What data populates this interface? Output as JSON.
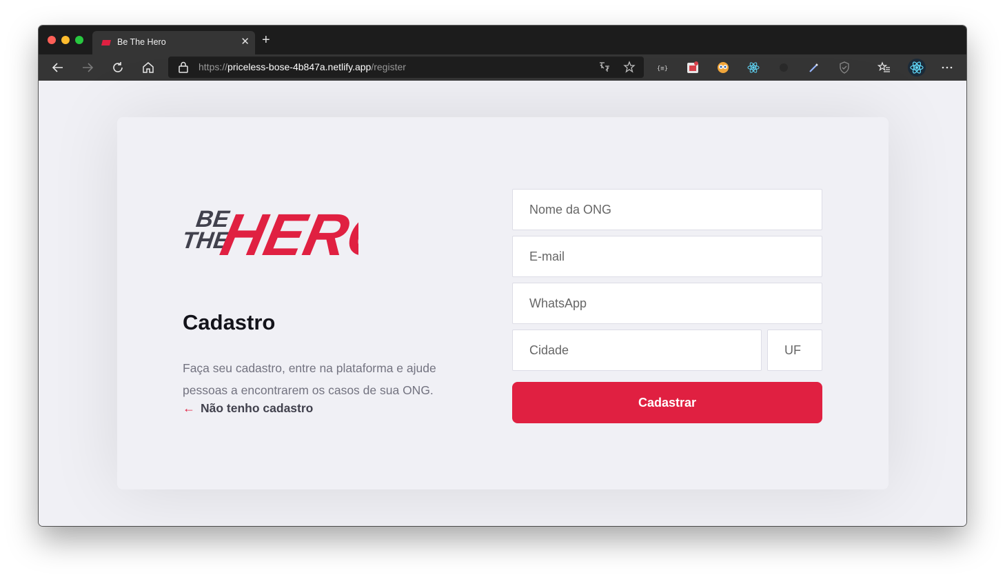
{
  "browser": {
    "tab": {
      "title": "Be The Hero"
    },
    "url": {
      "prefix": "https://",
      "host": "priceless-bose-4b847a.netlify.app",
      "path": "/register"
    },
    "icons": [
      "back-icon",
      "forward-icon",
      "reload-icon",
      "home-icon",
      "lock-icon",
      "translate-icon",
      "star-icon",
      "favorites-icon",
      "profile-icon",
      "more-icon"
    ]
  },
  "page": {
    "logo": {
      "line1": "BE",
      "line2": "THE",
      "hero": "HERO"
    },
    "title": "Cadastro",
    "description": "Faça seu cadastro, entre na plataforma e ajude pessoas a encontrarem os casos de sua ONG.",
    "back_link": "Não tenho cadastro",
    "form": {
      "name_placeholder": "Nome da ONG",
      "email_placeholder": "E-mail",
      "whatsapp_placeholder": "WhatsApp",
      "city_placeholder": "Cidade",
      "uf_placeholder": "UF",
      "submit_label": "Cadastrar"
    }
  },
  "colors": {
    "accent": "#e02041",
    "background": "#f0f0f5",
    "heading": "#13131a",
    "text": "#737380"
  }
}
